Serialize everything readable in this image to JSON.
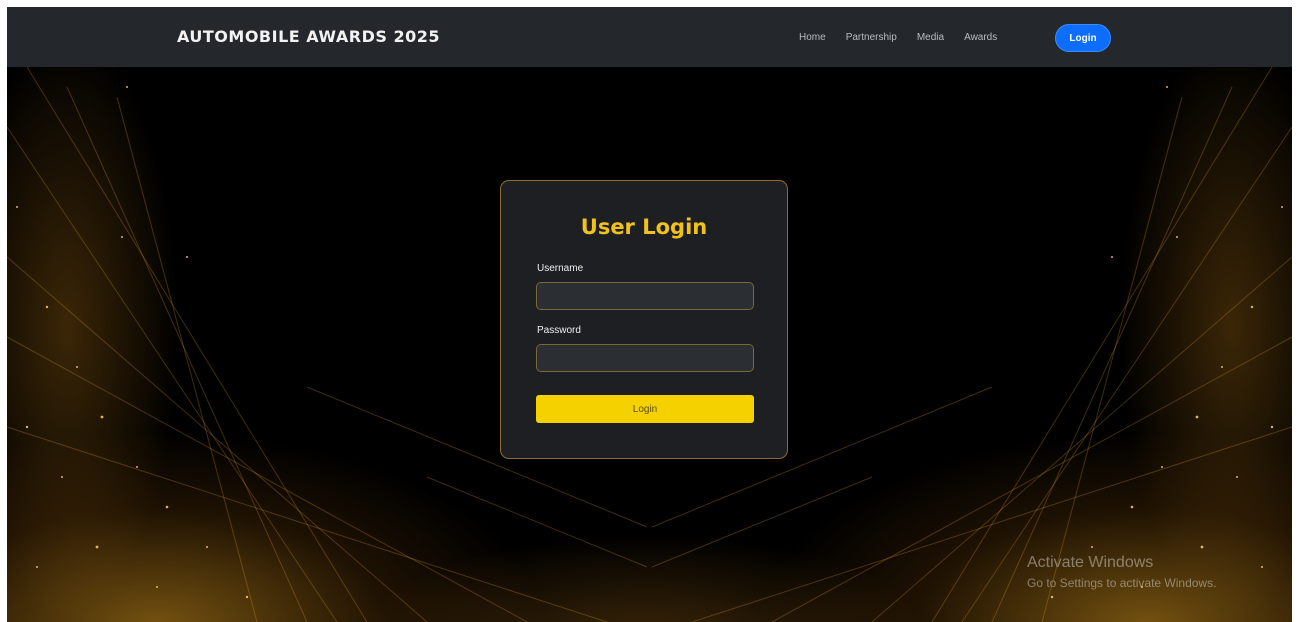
{
  "navbar": {
    "brand": "AUTOMOBILE AWARDS 2025",
    "links": [
      "Home",
      "Partnership",
      "Media",
      "Awards"
    ],
    "login_label": "Login"
  },
  "login_card": {
    "title": "User Login",
    "username_label": "Username",
    "username_value": "",
    "password_label": "Password",
    "password_value": "",
    "submit_label": "Login"
  },
  "watermark": {
    "line1": "Activate Windows",
    "line2": "Go to Settings to activate Windows."
  },
  "colors": {
    "navbar_bg": "#24272b",
    "accent_yellow": "#f6d100",
    "title_gold": "#f3c21a",
    "nav_login_blue": "#0d6efd",
    "card_border": "#8a6f2a"
  }
}
